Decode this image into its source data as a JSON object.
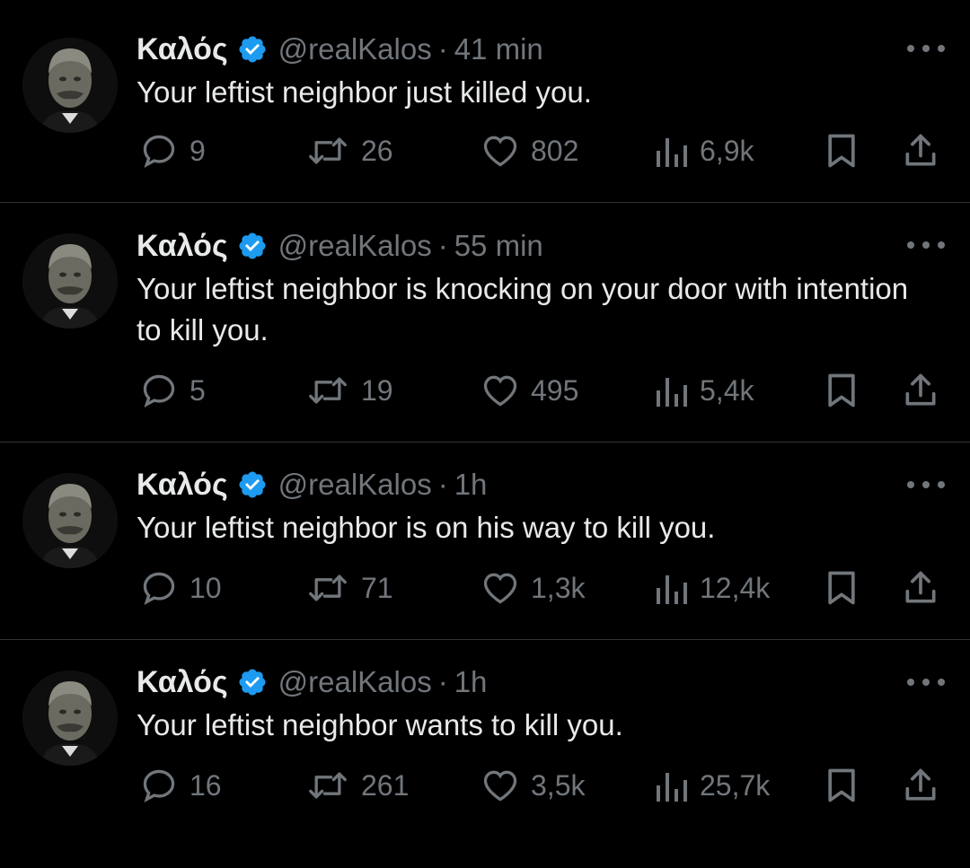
{
  "colors": {
    "background": "#000000",
    "text": "#e7e9ea",
    "muted": "#71767b",
    "verified": "#1d9bf0",
    "divider": "#2f3336"
  },
  "tweets": [
    {
      "name": "Καλός",
      "handle": "@realKalos",
      "separator": "·",
      "time": "41 min",
      "text": "Your leftist neighbor just killed you.",
      "replies": "9",
      "retweets": "26",
      "likes": "802",
      "views": "6,9k"
    },
    {
      "name": "Καλός",
      "handle": "@realKalos",
      "separator": "·",
      "time": "55 min",
      "text": "Your leftist neighbor is knocking on your door with intention to kill you.",
      "replies": "5",
      "retweets": "19",
      "likes": "495",
      "views": "5,4k"
    },
    {
      "name": "Καλός",
      "handle": "@realKalos",
      "separator": "·",
      "time": "1h",
      "text": "Your leftist neighbor is on his way to kill you.",
      "replies": "10",
      "retweets": "71",
      "likes": "1,3k",
      "views": "12,4k"
    },
    {
      "name": "Καλός",
      "handle": "@realKalos",
      "separator": "·",
      "time": "1h",
      "text": "Your leftist neighbor wants to kill you.",
      "replies": "16",
      "retweets": "261",
      "likes": "3,5k",
      "views": "25,7k"
    }
  ],
  "icons": {
    "reply": "reply-icon",
    "retweet": "retweet-icon",
    "like": "heart-icon",
    "views": "views-icon",
    "bookmark": "bookmark-icon",
    "share": "share-icon",
    "verified": "verified-badge-icon",
    "more": "more-options-icon"
  }
}
